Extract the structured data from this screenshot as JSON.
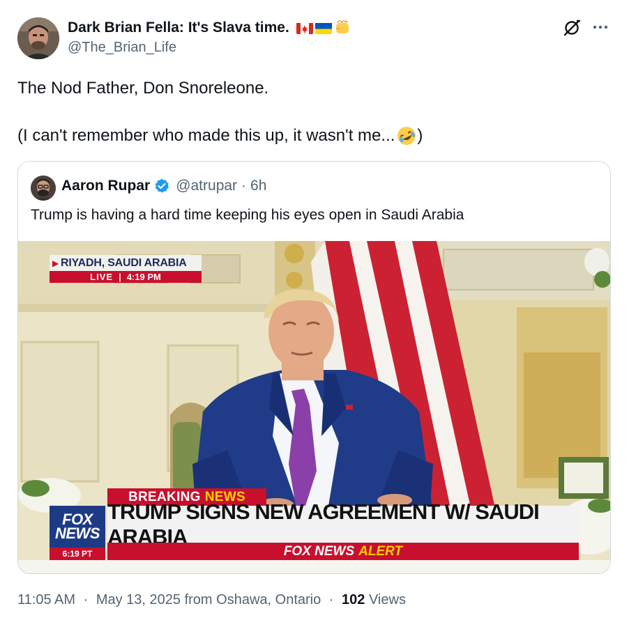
{
  "author": {
    "name": "Dark Brian Fella: It's Slava time.",
    "handle": "@The_Brian_Life",
    "name_emojis": [
      "flag-canada",
      "flag-ukraine",
      "fist-emoji"
    ]
  },
  "tweet": {
    "line1": "The Nod Father, Don Snoreleone.",
    "line2": "(I can't remember who made this up, it wasn't me...",
    "line2_emoji": "rofl-emoji",
    "line2_end": ")"
  },
  "quote": {
    "name": "Aaron Rupar",
    "verified": true,
    "handle": "@atrupar",
    "separator": "·",
    "time": "6h",
    "text": "Trump is having a hard time keeping his eyes open in Saudi Arabia",
    "media": {
      "location": "RIYADH, SAUDI ARABIA",
      "live_label": "LIVE",
      "live_time": "4:19 PM",
      "breaking_label": "BREAKING",
      "breaking_news": "NEWS",
      "network_logo": "FOX NEWS",
      "network_logo_line1": "FOX",
      "network_logo_line2": "NEWS",
      "network_time": "6:19 PT",
      "headline": "TRUMP SIGNS NEW AGREEMENT W/ SAUDI ARABIA",
      "alert_prefix": "FOX NEWS",
      "alert_word": "ALERT"
    }
  },
  "footer": {
    "time": "11:05 AM",
    "date": "May 13, 2025",
    "location": "from Oshawa, Ontario",
    "separator": "·",
    "views_count": "102",
    "views_label": "Views"
  },
  "colors": {
    "text": "#0f1419",
    "secondary": "#536471",
    "border": "#cfd9de",
    "verified": "#1d9bf0",
    "fox_red": "#c8102e",
    "fox_blue": "#1d3b85",
    "fox_yellow": "#ffd100"
  }
}
